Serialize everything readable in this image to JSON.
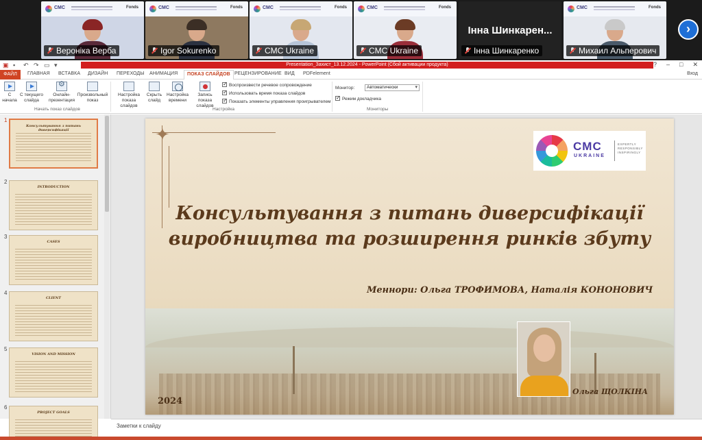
{
  "participants": [
    {
      "name": "Вероніка Верба",
      "type": "video",
      "hair": "#8a2525",
      "shirt": "#5a2a3a",
      "wall": "#cfd6e6"
    },
    {
      "name": "Igor Sokurenko",
      "type": "video",
      "hair": "#3b2e25",
      "shirt": "#2b3140",
      "wall": "#8e7960"
    },
    {
      "name": "CMC Ukraine",
      "type": "video",
      "hair": "#c7a774",
      "shirt": "#b7c5d8",
      "wall": "#e3e7ef",
      "active": true
    },
    {
      "name": "CMC Ukraine",
      "type": "video",
      "hair": "#6b3b25",
      "shirt": "#9a2e3a",
      "wall": "#e9ecf2"
    },
    {
      "name": "Інна Шинкаренко",
      "type": "text",
      "big": "Інна Шинкарен..."
    },
    {
      "name": "Михаил Альперович",
      "type": "video",
      "hair": "#c9c9c9",
      "shirt": "#4a5a6a",
      "wall": "#e6e9ef"
    }
  ],
  "participant_banner": {
    "logo_text": "CMC",
    "fund_text": "Fonds"
  },
  "window": {
    "title": "Presentation_Захист_13.12.2024 - PowerPoint (Сбой активации продукта)",
    "min": "–",
    "max": "□",
    "close": "✕",
    "help": "?",
    "login": "Вход"
  },
  "tabs": {
    "file": "ФАЙЛ",
    "home": "ГЛАВНАЯ",
    "insert": "ВСТАВКА",
    "design": "ДИЗАЙН",
    "transitions": "ПЕРЕХОДЫ",
    "animation": "АНИМАЦИЯ",
    "slideshow": "ПОКАЗ СЛАЙДОВ",
    "review": "РЕЦЕНЗИРОВАНИЕ",
    "view": "ВИД",
    "pdf": "PDFelement"
  },
  "ribbon": {
    "from_start": "С начала",
    "from_current": "С текущего слайда",
    "online": "Онлайн-презентация",
    "custom": "Произвольный показ",
    "group_start": "Начать показ слайдов",
    "setup": "Настройка показа слайдов",
    "hide": "Скрыть слайд",
    "timings": "Настройка времени",
    "record": "Запись показа слайдов",
    "chk_narration": "Воспроизвести речевое сопровождение",
    "chk_timings": "Использовать время показа слайдов",
    "chk_controls": "Показать элементы управления проигрывателем",
    "group_setup": "Настройка",
    "monitor_label": "Монитор:",
    "monitor_value": "Автоматически",
    "presenter_view": "Режим докладчика",
    "group_monitors": "Мониторы"
  },
  "thumbnails": [
    {
      "num": "1",
      "title": "Консультування з питань диверсифікації",
      "selected": true
    },
    {
      "num": "2",
      "title": "INTRODUCTION"
    },
    {
      "num": "3",
      "title": "CASES"
    },
    {
      "num": "4",
      "title": "CLIENT"
    },
    {
      "num": "5",
      "title": "VISION AND MISSION"
    },
    {
      "num": "6",
      "title": "PROJECT GOALS"
    }
  ],
  "slide": {
    "logo": {
      "cmc": "CMC",
      "ukraine": "UKRAINE",
      "tag1": "EXPERTLY",
      "tag2": "RESPONSIBLY",
      "tag3": "INSPIRINGLY"
    },
    "title_line1": "Консультування з питань диверсифікації",
    "title_line2": "виробництва та розширення ринків збуту",
    "mentors": "Меннори: Ольга ТРОФИМОВА, Наталія КОНОНОВИЧ",
    "presenter": "Ольга ЩОЛКІНА",
    "year": "2024"
  },
  "notes_placeholder": "Заметки к слайду",
  "icons": {
    "next": "chevron-right-icon"
  }
}
